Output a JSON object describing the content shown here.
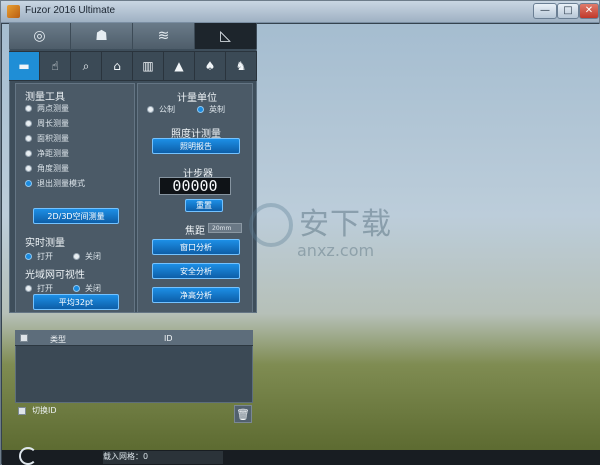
{
  "window": {
    "title": "Fuzor 2016 Ultimate",
    "buttons": [
      "—",
      "□",
      "✕"
    ]
  },
  "top_tabs": [
    {
      "icon": "compass-icon",
      "glyph": "◎"
    },
    {
      "icon": "people-icon",
      "glyph": "☗"
    },
    {
      "icon": "layers-icon",
      "glyph": "≋"
    },
    {
      "icon": "ruler-icon",
      "glyph": "◺"
    }
  ],
  "tools": [
    {
      "icon": "measure-icon",
      "glyph": "▬"
    },
    {
      "icon": "hand-icon",
      "glyph": "☝"
    },
    {
      "icon": "search-icon",
      "glyph": "⌕"
    },
    {
      "icon": "tag-icon",
      "glyph": "⌂"
    },
    {
      "icon": "window-icon",
      "glyph": "▥"
    },
    {
      "icon": "mountain-icon",
      "glyph": "▲"
    },
    {
      "icon": "tree-icon",
      "glyph": "♠"
    },
    {
      "icon": "animal-icon",
      "glyph": "♞"
    }
  ],
  "measurement_tools": {
    "title": "测量工具",
    "options": [
      "两点测量",
      "周长测量",
      "面积测量",
      "净距测量",
      "角度测量",
      "退出测量模式"
    ],
    "selected_index": 5,
    "button": "2D/3D空间测量"
  },
  "realtime": {
    "title": "实时测量",
    "on": "打开",
    "off": "关闭",
    "selected": "on"
  },
  "visibility": {
    "title": "光域网可视性",
    "on": "打开",
    "off": "关闭",
    "selected": "off",
    "button": "平均32pt"
  },
  "units": {
    "title": "计量单位",
    "imperial": "公制",
    "metric": "英制",
    "selected": "metric"
  },
  "illuminance": {
    "title": "照度计测量",
    "button": "照明报告"
  },
  "counter": {
    "title": "计步器",
    "value": "00000",
    "reset": "重置"
  },
  "focal": {
    "title": "焦距",
    "value": "20mm",
    "buttons": [
      "窗口分析",
      "安全分析",
      "净高分析"
    ]
  },
  "table": {
    "headers": [
      "类型",
      "ID"
    ],
    "switch_label": "切换ID"
  },
  "watermark": {
    "main": "安下载",
    "sub": "anxz.com"
  },
  "status": {
    "loaded_text": "载入网格：0"
  }
}
